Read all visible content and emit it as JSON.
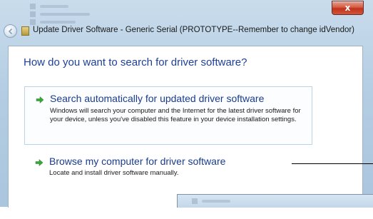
{
  "window": {
    "title": "Update Driver Software - Generic Serial (PROTOTYPE--Remember to change idVendor)",
    "close_label": "x"
  },
  "page": {
    "heading": "How do you want to search for driver software?"
  },
  "options": [
    {
      "title": "Search automatically for updated driver software",
      "description": "Windows will search your computer and the Internet for the latest driver software for your device, unless you've disabled this feature in your device installation settings."
    },
    {
      "title": "Browse my computer for driver software",
      "description": "Locate and install driver software manually."
    }
  ],
  "colors": {
    "heading": "#1e3f9a",
    "link": "#1a3c8e",
    "arrow": "#3aa63a",
    "close": "#c0321b"
  }
}
